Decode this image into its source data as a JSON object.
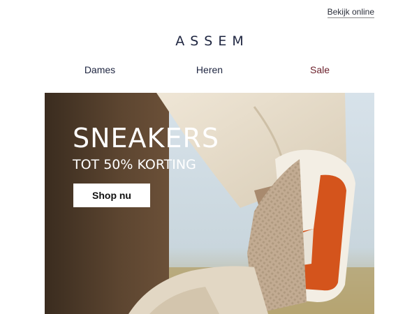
{
  "header": {
    "view_online": "Bekijk online",
    "logo": "ASSEM"
  },
  "nav": {
    "items": [
      "Dames",
      "Heren",
      "Sale"
    ],
    "sale_color": "#6b1f2a"
  },
  "hero": {
    "headline": "SNEAKERS",
    "subline": "TOT 50% KORTING",
    "cta": "Shop nu",
    "image": "sneaker-photo"
  }
}
